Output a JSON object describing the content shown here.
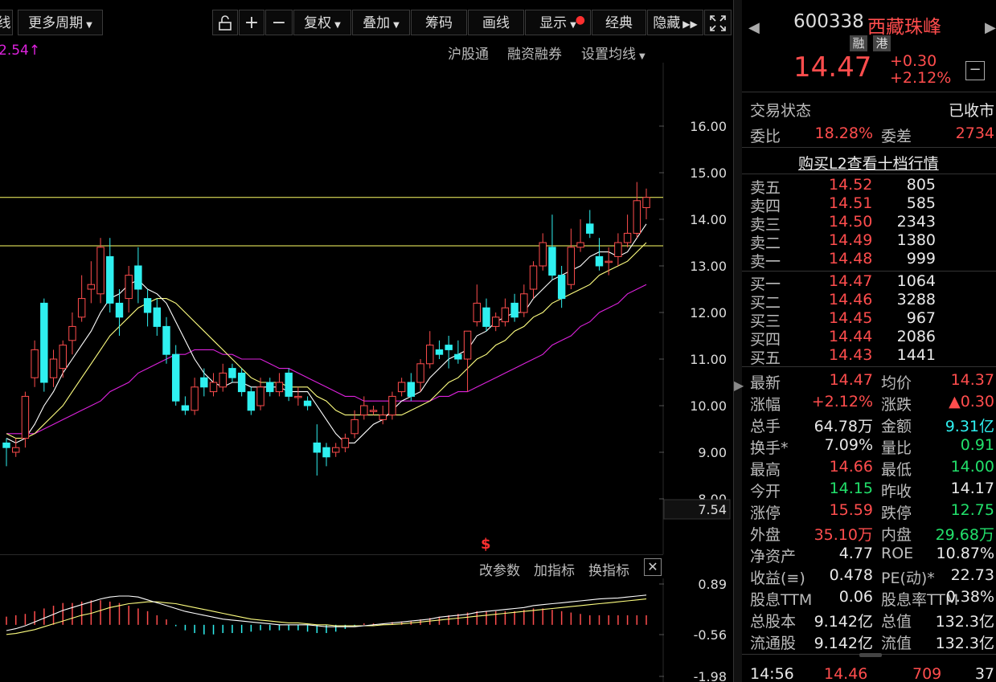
{
  "toolbar": {
    "period_prev": "线",
    "more_periods": "更多周期",
    "buttons": [
      "复权",
      "叠加",
      "筹码",
      "画线",
      "显示",
      "经典",
      "隐藏"
    ],
    "plus": "+",
    "minus": "−"
  },
  "subbar": {
    "price_marker": "2.54↑",
    "links": [
      "沪股通",
      "融资融券",
      "设置均线"
    ]
  },
  "indicator_bar": {
    "links": [
      "改参数",
      "加指标",
      "换指标"
    ]
  },
  "chart_data": {
    "type": "candlestick",
    "ylim": [
      7.54,
      16.5
    ],
    "y_ticks": [
      "16.00",
      "15.00",
      "14.00",
      "13.00",
      "12.00",
      "11.00",
      "10.00",
      "9.00",
      "8.00"
    ],
    "min_marker": "7.54",
    "resistance_lines": [
      14.47,
      13.43
    ],
    "candles": [
      [
        9.2,
        9.1,
        9.3,
        8.7
      ],
      [
        9.0,
        9.1,
        9.3,
        8.9
      ],
      [
        9.3,
        10.2,
        10.3,
        9.1
      ],
      [
        10.6,
        11.2,
        11.4,
        10.4
      ],
      [
        12.2,
        10.5,
        12.3,
        10.3
      ],
      [
        10.6,
        11.0,
        11.2,
        10.4
      ],
      [
        10.8,
        11.3,
        11.4,
        10.6
      ],
      [
        11.4,
        11.7,
        12.0,
        11.1
      ],
      [
        11.9,
        12.3,
        12.8,
        11.8
      ],
      [
        12.5,
        12.6,
        13.1,
        12.2
      ],
      [
        12.4,
        13.4,
        13.6,
        12.2
      ],
      [
        13.2,
        12.2,
        13.6,
        12.0
      ],
      [
        12.2,
        11.9,
        12.5,
        11.5
      ],
      [
        12.3,
        12.8,
        13.0,
        12.0
      ],
      [
        13.0,
        12.5,
        13.4,
        12.2
      ],
      [
        12.3,
        12.0,
        12.5,
        11.7
      ],
      [
        12.1,
        11.7,
        12.3,
        11.5
      ],
      [
        11.7,
        11.1,
        11.9,
        10.9
      ],
      [
        11.1,
        10.1,
        11.3,
        10.0
      ],
      [
        10.0,
        9.9,
        10.2,
        9.8
      ],
      [
        9.9,
        10.4,
        10.6,
        9.8
      ],
      [
        10.6,
        10.4,
        10.8,
        10.2
      ],
      [
        10.3,
        10.5,
        10.7,
        10.2
      ],
      [
        10.4,
        10.7,
        10.9,
        10.3
      ],
      [
        10.8,
        10.6,
        10.9,
        10.5
      ],
      [
        10.7,
        10.3,
        10.8,
        10.2
      ],
      [
        10.3,
        9.9,
        10.4,
        9.8
      ],
      [
        10.0,
        10.4,
        10.6,
        9.9
      ],
      [
        10.5,
        10.3,
        10.6,
        10.2
      ],
      [
        10.3,
        10.5,
        10.7,
        10.2
      ],
      [
        10.7,
        10.2,
        10.8,
        10.1
      ],
      [
        10.2,
        10.2,
        10.4,
        10.0
      ],
      [
        10.1,
        10.0,
        10.2,
        9.9
      ],
      [
        9.2,
        9.0,
        9.6,
        8.5
      ],
      [
        9.1,
        8.9,
        9.2,
        8.7
      ],
      [
        9.0,
        9.1,
        9.2,
        8.9
      ],
      [
        9.1,
        9.3,
        9.4,
        9.0
      ],
      [
        9.4,
        9.7,
        9.9,
        9.3
      ],
      [
        9.8,
        10.0,
        10.2,
        9.7
      ],
      [
        9.9,
        9.9,
        10.0,
        9.8
      ],
      [
        9.7,
        9.8,
        10.0,
        9.6
      ],
      [
        9.8,
        10.2,
        10.3,
        9.7
      ],
      [
        10.3,
        10.5,
        10.6,
        10.2
      ],
      [
        10.5,
        10.2,
        10.7,
        10.1
      ],
      [
        10.5,
        10.9,
        11.0,
        10.3
      ],
      [
        10.9,
        11.3,
        11.6,
        10.8
      ],
      [
        11.2,
        11.1,
        11.4,
        11.0
      ],
      [
        11.3,
        11.2,
        11.5,
        10.8
      ],
      [
        11.1,
        11.0,
        11.4,
        10.9
      ],
      [
        11.0,
        11.6,
        11.6,
        10.3
      ],
      [
        11.8,
        12.2,
        12.6,
        11.7
      ],
      [
        12.1,
        11.7,
        12.3,
        11.6
      ],
      [
        11.7,
        11.9,
        12.0,
        11.6
      ],
      [
        11.8,
        12.1,
        12.3,
        11.7
      ],
      [
        12.2,
        11.9,
        12.4,
        11.8
      ],
      [
        12.0,
        12.4,
        12.6,
        11.9
      ],
      [
        12.5,
        13.0,
        13.1,
        12.3
      ],
      [
        13.0,
        13.5,
        13.7,
        12.9
      ],
      [
        13.4,
        12.8,
        14.1,
        12.7
      ],
      [
        12.8,
        12.3,
        13.0,
        12.1
      ],
      [
        12.6,
        13.4,
        13.8,
        12.5
      ],
      [
        13.4,
        13.5,
        14.0,
        13.3
      ],
      [
        13.9,
        13.7,
        14.2,
        13.6
      ],
      [
        13.2,
        13.0,
        13.6,
        12.9
      ],
      [
        13.1,
        13.1,
        13.4,
        12.8
      ],
      [
        13.2,
        13.5,
        13.7,
        13.0
      ],
      [
        13.5,
        13.7,
        14.1,
        13.4
      ],
      [
        13.7,
        14.4,
        14.8,
        13.6
      ],
      [
        14.25,
        14.47,
        14.66,
        14.0
      ]
    ],
    "ma5": [
      9.3,
      9.2,
      9.3,
      9.6,
      10.0,
      10.3,
      10.7,
      11.0,
      11.3,
      11.6,
      12.0,
      12.3,
      12.4,
      12.6,
      12.7,
      12.5,
      12.4,
      12.2,
      11.8,
      11.4,
      11.0,
      10.7,
      10.5,
      10.4,
      10.5,
      10.5,
      10.4,
      10.4,
      10.4,
      10.4,
      10.3,
      10.3,
      10.3,
      10.0,
      9.7,
      9.4,
      9.2,
      9.2,
      9.4,
      9.6,
      9.7,
      9.9,
      10.1,
      10.2,
      10.3,
      10.6,
      10.8,
      11.0,
      11.1,
      11.2,
      11.5,
      11.6,
      11.8,
      11.9,
      12.0,
      12.0,
      12.3,
      12.5,
      12.7,
      12.8,
      12.9,
      13.0,
      13.2,
      13.3,
      13.3,
      13.2,
      13.3,
      13.6,
      13.9
    ],
    "ma10": [
      9.4,
      9.3,
      9.3,
      9.4,
      9.6,
      9.8,
      10.0,
      10.3,
      10.6,
      10.9,
      11.2,
      11.5,
      11.7,
      11.9,
      12.1,
      12.2,
      12.3,
      12.3,
      12.2,
      12.0,
      11.8,
      11.6,
      11.4,
      11.2,
      11.0,
      10.8,
      10.6,
      10.5,
      10.5,
      10.5,
      10.4,
      10.4,
      10.4,
      10.2,
      10.1,
      9.9,
      9.8,
      9.8,
      9.8,
      9.8,
      9.8,
      9.8,
      9.8,
      9.9,
      10.0,
      10.1,
      10.3,
      10.5,
      10.6,
      10.8,
      11.0,
      11.1,
      11.3,
      11.4,
      11.6,
      11.7,
      11.9,
      12.0,
      12.2,
      12.3,
      12.4,
      12.5,
      12.6,
      12.8,
      12.9,
      13.0,
      13.1,
      13.3,
      13.5
    ],
    "ma30": [
      9.4,
      9.4,
      9.4,
      9.4,
      9.5,
      9.6,
      9.7,
      9.8,
      9.9,
      10.0,
      10.1,
      10.3,
      10.4,
      10.5,
      10.7,
      10.8,
      10.9,
      11.0,
      11.1,
      11.1,
      11.2,
      11.2,
      11.2,
      11.1,
      11.1,
      11.0,
      11.0,
      11.0,
      10.9,
      10.8,
      10.8,
      10.7,
      10.6,
      10.5,
      10.4,
      10.3,
      10.2,
      10.2,
      10.1,
      10.1,
      10.1,
      10.1,
      10.1,
      10.1,
      10.1,
      10.1,
      10.2,
      10.2,
      10.3,
      10.3,
      10.4,
      10.5,
      10.6,
      10.7,
      10.8,
      10.9,
      11.0,
      11.1,
      11.3,
      11.4,
      11.5,
      11.7,
      11.8,
      12.0,
      12.1,
      12.2,
      12.4,
      12.5,
      12.6
    ],
    "macd_ticks": [
      "0.89",
      "-0.56",
      "-1.98"
    ],
    "macd_hist": [
      0.3,
      0.35,
      0.4,
      0.5,
      0.6,
      0.7,
      0.8,
      0.8,
      0.85,
      0.9,
      0.9,
      0.85,
      0.8,
      0.7,
      0.6,
      0.5,
      0.35,
      0.2,
      -0.05,
      -0.2,
      -0.3,
      -0.35,
      -0.35,
      -0.3,
      -0.3,
      -0.3,
      -0.25,
      -0.2,
      -0.2,
      -0.2,
      -0.2,
      -0.2,
      -0.25,
      -0.3,
      -0.3,
      -0.25,
      -0.15,
      -0.05,
      0.05,
      0.05,
      0.05,
      0.1,
      0.12,
      0.15,
      0.2,
      0.25,
      0.3,
      0.35,
      0.4,
      0.45,
      0.5,
      0.5,
      0.5,
      0.5,
      0.5,
      0.55,
      0.6,
      0.6,
      0.55,
      0.5,
      0.45,
      0.4,
      0.35,
      0.35,
      0.35,
      0.35,
      0.35,
      0.35,
      0.35
    ],
    "dif": [
      -0.9,
      -0.8,
      -0.65,
      -0.45,
      -0.25,
      -0.05,
      0.15,
      0.3,
      0.45,
      0.6,
      0.75,
      0.85,
      0.9,
      0.9,
      0.85,
      0.7,
      0.55,
      0.4,
      0.25,
      0.1,
      0.0,
      -0.1,
      -0.2,
      -0.3,
      -0.35,
      -0.4,
      -0.45,
      -0.5,
      -0.55,
      -0.6,
      -0.6,
      -0.6,
      -0.6,
      -0.65,
      -0.7,
      -0.7,
      -0.7,
      -0.7,
      -0.65,
      -0.6,
      -0.55,
      -0.5,
      -0.45,
      -0.4,
      -0.35,
      -0.3,
      -0.2,
      -0.15,
      -0.1,
      -0.05,
      0.05,
      0.1,
      0.15,
      0.2,
      0.25,
      0.3,
      0.4,
      0.45,
      0.5,
      0.55,
      0.6,
      0.65,
      0.7,
      0.75,
      0.78,
      0.8,
      0.85,
      0.9,
      0.95
    ],
    "dea": [
      -1.1,
      -1.05,
      -0.95,
      -0.85,
      -0.7,
      -0.55,
      -0.4,
      -0.25,
      -0.1,
      0.0,
      0.15,
      0.3,
      0.4,
      0.5,
      0.55,
      0.6,
      0.6,
      0.55,
      0.5,
      0.4,
      0.3,
      0.2,
      0.1,
      0.0,
      -0.1,
      -0.2,
      -0.3,
      -0.35,
      -0.4,
      -0.45,
      -0.5,
      -0.5,
      -0.55,
      -0.6,
      -0.6,
      -0.65,
      -0.65,
      -0.65,
      -0.65,
      -0.65,
      -0.6,
      -0.58,
      -0.55,
      -0.5,
      -0.45,
      -0.4,
      -0.35,
      -0.3,
      -0.25,
      -0.2,
      -0.15,
      -0.1,
      -0.05,
      0.0,
      0.05,
      0.1,
      0.15,
      0.2,
      0.25,
      0.3,
      0.35,
      0.4,
      0.45,
      0.5,
      0.55,
      0.6,
      0.65,
      0.7,
      0.75
    ]
  },
  "quote": {
    "code": "600338",
    "name": "西藏珠峰",
    "tags": [
      "融",
      "港"
    ],
    "price": "14.47",
    "change": "+0.30",
    "change_pct": "+2.12%",
    "trade_status_label": "交易状态",
    "trade_status": "已收市",
    "wb_label": "委比",
    "wb_value": "18.28%",
    "wc_label": "委差",
    "wc_value": "2734",
    "l2_link": "购买L2查看十档行情",
    "asks": [
      {
        "label": "卖五",
        "price": "14.52",
        "vol": "805"
      },
      {
        "label": "卖四",
        "price": "14.51",
        "vol": "585"
      },
      {
        "label": "卖三",
        "price": "14.50",
        "vol": "2343"
      },
      {
        "label": "卖二",
        "price": "14.49",
        "vol": "1380"
      },
      {
        "label": "卖一",
        "price": "14.48",
        "vol": "999"
      }
    ],
    "bids": [
      {
        "label": "买一",
        "price": "14.47",
        "vol": "1064"
      },
      {
        "label": "买二",
        "price": "14.46",
        "vol": "3288"
      },
      {
        "label": "买三",
        "price": "14.45",
        "vol": "967"
      },
      {
        "label": "买四",
        "price": "14.44",
        "vol": "2086"
      },
      {
        "label": "买五",
        "price": "14.43",
        "vol": "1441"
      }
    ],
    "stats": [
      {
        "l1": "最新",
        "v1": "14.47",
        "c1": "red",
        "l2": "均价",
        "v2": "14.37",
        "c2": "red"
      },
      {
        "l1": "涨幅",
        "v1": "+2.12%",
        "c1": "red",
        "l2": "涨跌",
        "v2": "▲0.30",
        "c2": "red"
      },
      {
        "l1": "总手",
        "v1": "64.78万",
        "c1": "white",
        "l2": "金额",
        "v2": "9.31亿",
        "c2": "cyan"
      },
      {
        "l1": "换手*",
        "v1": "7.09%",
        "c1": "white",
        "l2": "量比",
        "v2": "0.91",
        "c2": "green"
      },
      {
        "l1": "最高",
        "v1": "14.66",
        "c1": "red",
        "l2": "最低",
        "v2": "14.00",
        "c2": "green"
      },
      {
        "l1": "今开",
        "v1": "14.15",
        "c1": "green",
        "l2": "昨收",
        "v2": "14.17",
        "c2": "white"
      },
      {
        "l1": "涨停",
        "v1": "15.59",
        "c1": "red",
        "l2": "跌停",
        "v2": "12.75",
        "c2": "green"
      },
      {
        "l1": "外盘",
        "v1": "35.10万",
        "c1": "red",
        "l2": "内盘",
        "v2": "29.68万",
        "c2": "green"
      },
      {
        "l1": "净资产",
        "v1": "4.77",
        "c1": "white",
        "l2": "ROE",
        "v2": "10.87%",
        "c2": "white"
      },
      {
        "l1": "收益(≡)",
        "v1": "0.478",
        "c1": "white",
        "l2": "PE(动)*",
        "v2": "22.73",
        "c2": "white"
      },
      {
        "l1": "股息TTM",
        "v1": "0.06",
        "c1": "white",
        "l2": "股息率TTM",
        "v2": "0.38%",
        "c2": "white"
      },
      {
        "l1": "总股本",
        "v1": "9.142亿",
        "c1": "white",
        "l2": "总值",
        "v2": "132.3亿",
        "c2": "white"
      },
      {
        "l1": "流通股",
        "v1": "9.142亿",
        "c1": "white",
        "l2": "流值",
        "v2": "132.3亿",
        "c2": "white"
      }
    ],
    "tick": {
      "time": "14:56",
      "price": "14.46",
      "vol": "709",
      "extra": "37"
    }
  },
  "colors": {
    "up": "#ff4d4d",
    "down": "#2ff0f0",
    "ma5": "#ffffff",
    "ma10": "#ffff80",
    "ma30": "#dd22dd",
    "hline": "#ffff66"
  }
}
